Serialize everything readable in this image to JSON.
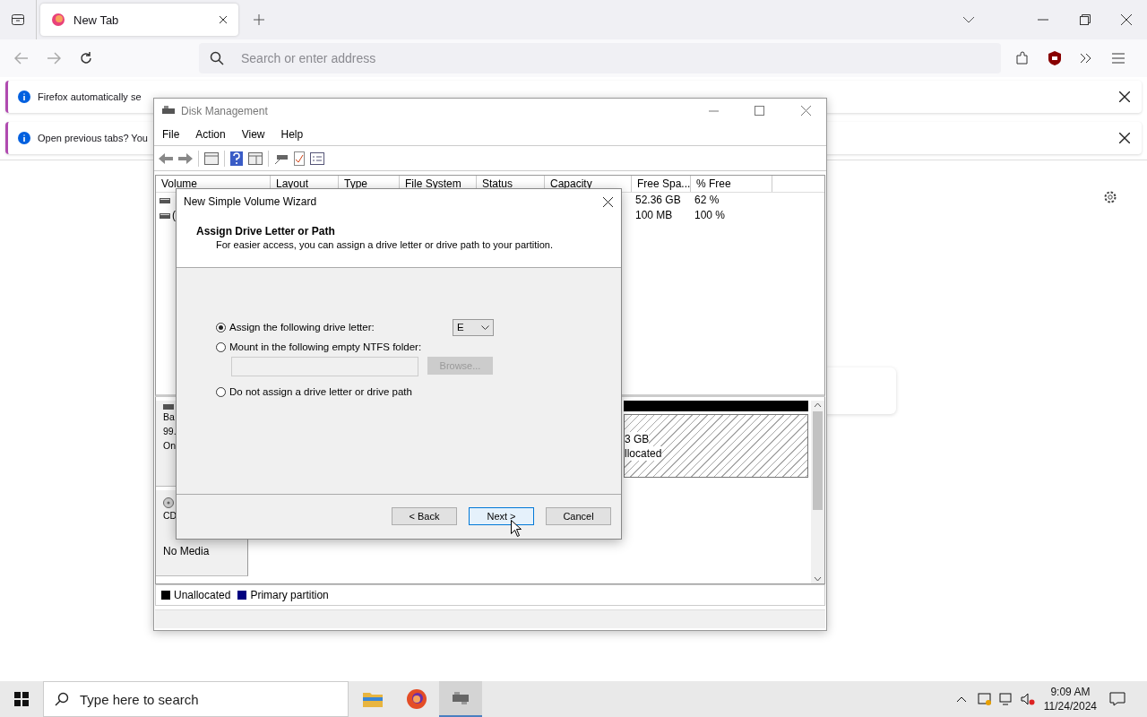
{
  "browser": {
    "tabs": [
      {
        "title": "New Tab",
        "selected": true
      }
    ],
    "address_placeholder": "Search or enter address",
    "notifications": [
      {
        "text": "Firefox automatically se"
      },
      {
        "text": "Open previous tabs? You"
      }
    ]
  },
  "disk_management": {
    "title": "Disk Management",
    "menu": [
      "File",
      "Action",
      "View",
      "Help"
    ],
    "columns": [
      "Volume",
      "Layout",
      "Type",
      "File System",
      "Status",
      "Capacity",
      "Free Spa...",
      "% Free"
    ],
    "rows": [
      {
        "volume": "",
        "free_space": "52.36 GB",
        "percent_free": "62 %"
      },
      {
        "volume": "(",
        "free_space": "100 MB",
        "percent_free": "100 %"
      }
    ],
    "disks": [
      {
        "kind": "basic",
        "lines": [
          "Ba",
          "99.",
          "On"
        ],
        "partition_lines": [
          "3 GB",
          "llocated"
        ]
      },
      {
        "kind": "cdrom",
        "lines": [
          "CD"
        ],
        "status": "No Media"
      }
    ],
    "legend": [
      {
        "label": "Unallocated",
        "color": "#000000"
      },
      {
        "label": "Primary partition",
        "color": "#000080"
      }
    ]
  },
  "wizard": {
    "title": "New Simple Volume Wizard",
    "heading": "Assign Drive Letter or Path",
    "subheading": "For easier access, you can assign a drive letter or drive path to your partition.",
    "options": [
      {
        "kind": "letter",
        "label": "Assign the following drive letter:",
        "selected": true
      },
      {
        "kind": "folder",
        "label": "Mount in the following empty NTFS folder:",
        "selected": false
      },
      {
        "kind": "none",
        "label": "Do not assign a drive letter or drive path",
        "selected": false
      }
    ],
    "drive_letter": "E",
    "folder": {
      "disabled": true
    },
    "browse": {
      "label": "Browse...",
      "disabled": true
    },
    "buttons": [
      {
        "label": "< Back",
        "focused": false
      },
      {
        "label": "Next >",
        "focused": true
      },
      {
        "label": "Cancel",
        "focused": false
      }
    ]
  },
  "taskbar": {
    "search_placeholder": "Type here to search",
    "time": "9:09 AM",
    "date": "11/24/2024"
  }
}
